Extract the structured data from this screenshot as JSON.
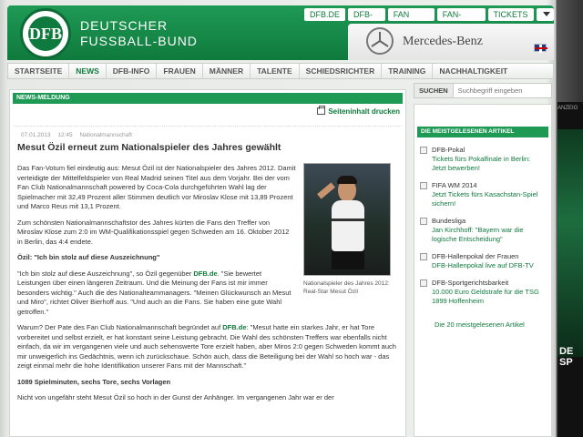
{
  "header": {
    "brand_line1": "DEUTSCHER",
    "brand_line2": "FUSSBALL-BUND",
    "logo_text": "DFB",
    "top_links": [
      "DFB.DE",
      "DFB-TV",
      "FAN CLUB",
      "FAN-SHOP",
      "TICKETS"
    ],
    "sponsor": "Mercedes-Benz"
  },
  "nav": {
    "items": [
      "Startseite",
      "News",
      "DFB-Info",
      "Frauen",
      "Männer",
      "Talente",
      "Schiedsrichter",
      "Training",
      "Nachhaltigkeit"
    ],
    "active": "News"
  },
  "article": {
    "section_label": "News-Meldung",
    "print_label": "Seiteninhalt drucken",
    "date": "07.01.2013",
    "time": "12:45",
    "category": "Nationalmannschaft",
    "headline": "Mesut Özil erneut zum Nationalspieler des Jahres gewählt",
    "p1": "Das Fan-Votum fiel eindeutig aus: Mesut Özil ist der Nationalspieler des Jahres 2012. Damit verteidigte der Mittelfeldspieler von Real Madrid seinen Titel aus dem Vorjahr. Bei der vom Fan Club Nationalmannschaft powered by Coca-Cola durchgeführten Wahl lag der Spielmacher mit 32,49 Prozent aller Stimmen deutlich vor Miroslav Klose mit 13,89 Prozent und Marco Reus mit 13,1 Prozent.",
    "p2": "Zum schönsten Nationalmannschaftstor des Jahres kürten die Fans den Treffer von Miroslav Klose zum 2:0 im WM-Qualifikationsspiel gegen Schweden am 16. Oktober 2012 in Berlin, das 4:4 endete.",
    "subhead1": "Özil: \"Ich bin stolz auf diese Auszeichnung\"",
    "p3a": "\"Ich bin stolz auf diese Auszeichnung\", so Özil gegenüber ",
    "p3_link": "DFB.de",
    "p3b": ". \"Sie bewertet Leistungen über einen längeren Zeitraum. Und die Meinung der Fans ist mir immer besonders wichtig.\" Auch die des Nationalteammanagers. \"Meinen Glückwunsch an Mesut und Miro\", richtet Oliver Bierhoff aus. \"Und auch an die Fans. Sie haben eine gute Wahl getroffen.\"",
    "p4a": "Warum? Der Pate des Fan Club Nationalmannschaft begründet auf ",
    "p4_link": "DFB.de",
    "p4b": ": \"Mesut hatte ein starkes Jahr, er hat Tore vorbereitet und selbst erzielt, er hat konstant seine Leistung gebracht. Die Wahl des schönsten Treffers war ebenfalls nicht einfach, da wir im vergangenen viele und auch sehenswerte Tore erzielt haben, aber Miros 2:0 gegen Schweden kommt auch mir unweigerlich ins Gedächtnis, wenn ich zurückschaue. Schön auch, dass die Beteiligung bei der Wahl so hoch war - das zeigt einmal mehr die hohe Identifikation unserer Fans mit der Mannschaft.\"",
    "subhead2": "1089 Spielminuten, sechs Tore, sechs Vorlagen",
    "p5": "Nicht von ungefähr steht Mesut Özil so hoch in der Gunst der Anhänger. Im vergangenen Jahr war er der",
    "photo_caption": "Nationalspieler des Jahres 2012: Real-Star Mesut Özil"
  },
  "search": {
    "label": "SUCHEN",
    "placeholder": "Suchbegriff eingeben"
  },
  "popular": {
    "title": "Die meistgelesenen Artikel",
    "items": [
      {
        "category": "DFB-Pokal",
        "title": "Tickets fürs Pokalfinale in Berlin: Jetzt bewerben!"
      },
      {
        "category": "FIFA WM 2014",
        "title": "Jetzt Tickets fürs Kasachstan-Spiel sichern!"
      },
      {
        "category": "Bundesliga",
        "title": "Jan Kirchhoff: \"Bayern war die logische Entscheidung\""
      },
      {
        "category": "DFB-Hallenpokal der Frauen",
        "title": "DFB-Hallenpokal live auf DFB-TV"
      },
      {
        "category": "DFB-Sportgerichtsbarkeit",
        "title": "10.000 Euro Geldstrafe für die TSG 1899 Hoffenheim"
      }
    ],
    "all_link": "Die 20 meistgelesenen Artikel"
  },
  "promo": {
    "top_label": "ANZEIG",
    "text_line1": "DE",
    "text_line2": "SP"
  }
}
